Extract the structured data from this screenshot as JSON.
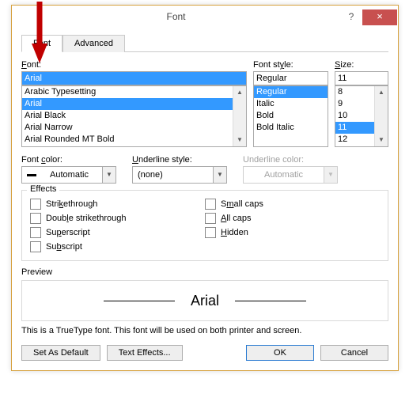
{
  "dialog": {
    "title": "Font",
    "help": "?",
    "close": "×"
  },
  "tabs": {
    "font": "Font",
    "advanced": "Advanced"
  },
  "labels": {
    "font": "Font:",
    "style": "Font style:",
    "size": "Size:",
    "fontcolor": "Font color:",
    "underlinestyle": "Underline style:",
    "underlinecolor": "Underline color:",
    "effects": "Effects",
    "preview": "Preview"
  },
  "font": {
    "value": "Arial",
    "list": [
      "Arabic Typesetting",
      "Arial",
      "Arial Black",
      "Arial Narrow",
      "Arial Rounded MT Bold"
    ],
    "selected_index": 1
  },
  "style": {
    "value": "Regular",
    "list": [
      "Regular",
      "Italic",
      "Bold",
      "Bold Italic"
    ],
    "selected_index": 0
  },
  "size": {
    "value": "11",
    "list": [
      "8",
      "9",
      "10",
      "11",
      "12"
    ],
    "selected_index": 3
  },
  "fontcolor": {
    "value": "Automatic"
  },
  "underlinestyle": {
    "value": "(none)"
  },
  "underlinecolor": {
    "value": "Automatic"
  },
  "effects": {
    "strikethrough": "Strikethrough",
    "doublestrike": "Double strikethrough",
    "superscript": "Superscript",
    "subscript": "Subscript",
    "smallcaps": "Small caps",
    "allcaps": "All caps",
    "hidden": "Hidden"
  },
  "preview": {
    "text": "Arial"
  },
  "note": "This is a TrueType font. This font will be used on both printer and screen.",
  "buttons": {
    "setdefault": "Set As Default",
    "texteffects": "Text Effects...",
    "ok": "OK",
    "cancel": "Cancel"
  }
}
